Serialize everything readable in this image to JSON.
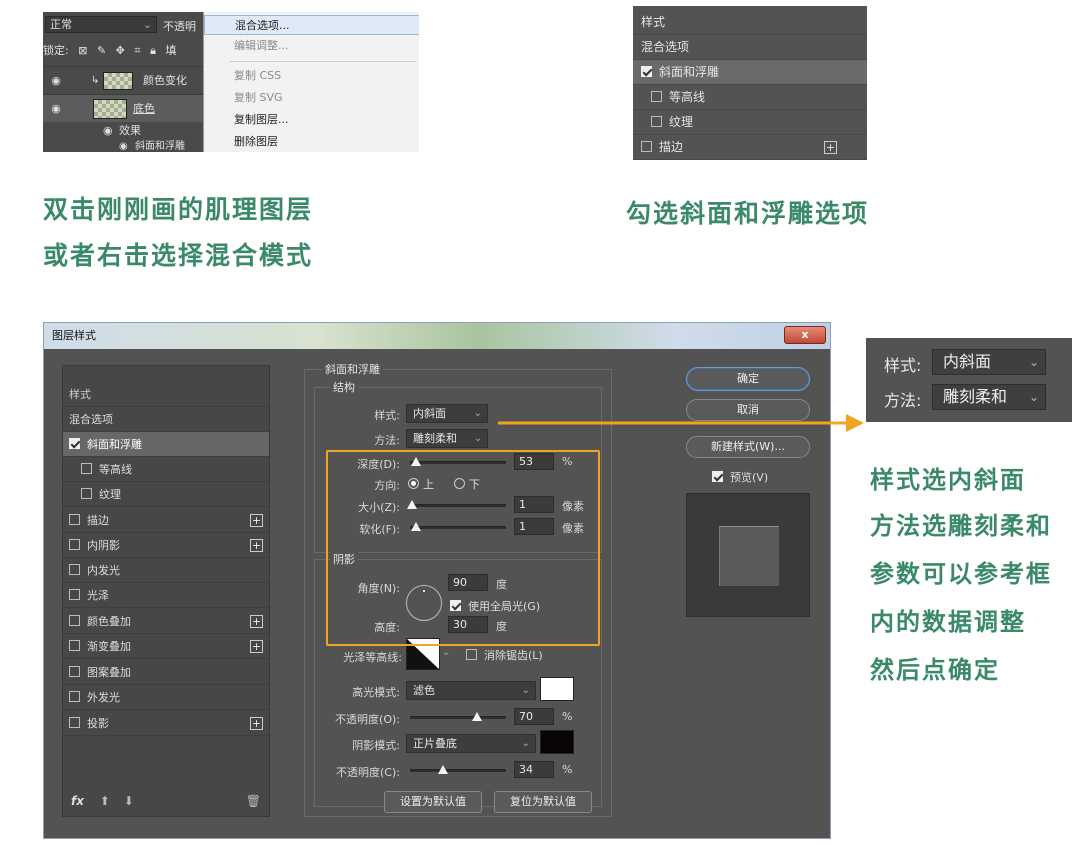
{
  "panel_a": {
    "blend_mode": "正常",
    "opacity_label": "不透明",
    "lock_label": "锁定:",
    "fill_label": "填",
    "layers": [
      {
        "name": "颜色变化"
      },
      {
        "name": "底色"
      }
    ],
    "effects_label": "效果",
    "effect_child": "斜面和浮雕",
    "menu": [
      "混合选项...",
      "编辑调整...",
      "复制 CSS",
      "复制 SVG",
      "复制图层...",
      "删除图层"
    ]
  },
  "panel_b": {
    "items": [
      "样式",
      "混合选项",
      "斜面和浮雕",
      "等高线",
      "纹理",
      "描边"
    ]
  },
  "captions": {
    "left_line1": "双击刚刚画的肌理图层",
    "left_line2": "或者右击选择混合模式",
    "right": "勾选斜面和浮雕选项"
  },
  "dialog": {
    "title": "图层样式",
    "close": "x",
    "styles": [
      "样式",
      "混合选项",
      "斜面和浮雕",
      "等高线",
      "纹理",
      "描边",
      "内阴影",
      "内发光",
      "光泽",
      "颜色叠加",
      "渐变叠加",
      "图案叠加",
      "外发光",
      "投影"
    ],
    "fx_label": "fx",
    "section_title": "斜面和浮雕",
    "structure_label": "结构",
    "style_label": "样式:",
    "style_value": "内斜面",
    "technique_label": "方法:",
    "technique_value": "雕刻柔和",
    "depth_label": "深度(D):",
    "depth_value": "53",
    "depth_unit": "%",
    "direction_label": "方向:",
    "direction_up": "上",
    "direction_down": "下",
    "size_label": "大小(Z):",
    "size_value": "1",
    "size_unit": "像素",
    "soften_label": "软化(F):",
    "soften_value": "1",
    "soften_unit": "像素",
    "shading_label": "阴影",
    "angle_label": "角度(N):",
    "angle_value": "90",
    "angle_unit": "度",
    "global_light_label": "使用全局光(G)",
    "altitude_label": "高度:",
    "altitude_value": "30",
    "altitude_unit": "度",
    "gloss_label": "光泽等高线:",
    "antialias_label": "消除锯齿(L)",
    "highlight_mode_label": "高光模式:",
    "highlight_mode_value": "滤色",
    "highlight_opacity_label": "不透明度(O):",
    "highlight_opacity_value": "70",
    "highlight_opacity_unit": "%",
    "shadow_mode_label": "阴影模式:",
    "shadow_mode_value": "正片叠底",
    "shadow_opacity_label": "不透明度(C):",
    "shadow_opacity_value": "34",
    "shadow_opacity_unit": "%",
    "make_default": "设置为默认值",
    "reset_default": "复位为默认值",
    "ok": "确定",
    "cancel": "取消",
    "new_style": "新建样式(W)...",
    "preview_label": "预览(V)",
    "highlight_color": "#ffffff",
    "shadow_color": "#0a0406"
  },
  "callout": {
    "style_label": "样式:",
    "style_value": "内斜面",
    "technique_label": "方法:",
    "technique_value": "雕刻柔和"
  },
  "right_notes": [
    "样式选内斜面",
    "方法选雕刻柔和",
    "参数可以参考框",
    "内的数据调整",
    "然后点确定"
  ],
  "colors": {
    "caption_green": "#3a8a68",
    "highlight_orange": "#f0a41f"
  }
}
